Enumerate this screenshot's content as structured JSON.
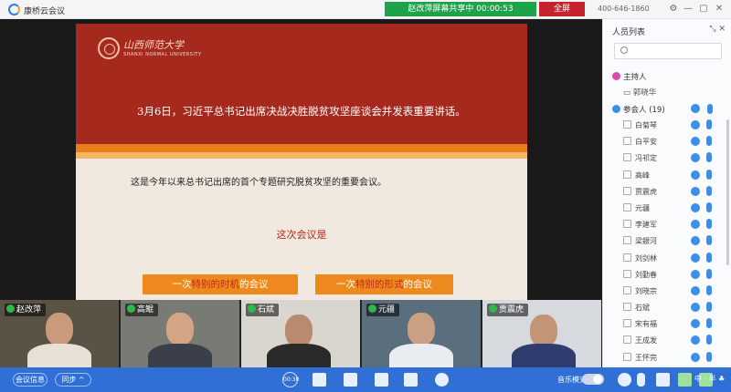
{
  "app": {
    "title": "康桥云会议",
    "hotline": "400-646-1860"
  },
  "share_bar": {
    "text": "赵改萍屏幕共享中 00:00:53",
    "fullscreen_label": "全屏"
  },
  "slide": {
    "school_name": "山西师范大学",
    "school_name_en": "SHANXI NORMAL UNIVERSITY",
    "headline": "3月6日，习近平总书记出席决战决胜脱贫攻坚座谈会并发表重要讲话。",
    "line1": "这是今年以来总书记出席的首个专题研究脱贫攻坚的重要会议。",
    "line2": "这次会议是",
    "box1": {
      "pre": "一次",
      "hl": "特别的时机",
      "post": "的会议"
    },
    "box2": {
      "pre": "一次",
      "hl": "特别的形式",
      "post": "的会议"
    },
    "colors": {
      "banner": "#a6291e",
      "box": "#ee8a1d"
    }
  },
  "thumbnails": [
    {
      "name": "赵改萍"
    },
    {
      "name": "高鲲"
    },
    {
      "name": "石斌"
    },
    {
      "name": "元疆"
    },
    {
      "name": "贾震虎"
    }
  ],
  "panel": {
    "title": "人员列表",
    "host_label": "主持人",
    "host_name": "郭晓华",
    "attendee_label": "参会人 (19)",
    "attendees": [
      "白菊琴",
      "白平安",
      "冯祁定",
      "高峰",
      "贾震虎",
      "元疆",
      "李建军",
      "梁銀河",
      "刘剑林",
      "刘勤春",
      "刘晓宗",
      "石斌",
      "宋有福",
      "王成发",
      "王怀完"
    ]
  },
  "toolbar": {
    "meeting_info": "会议信息",
    "sync": "同步 ^",
    "timer": "00:30",
    "music_mode": "音乐模式",
    "ime": "中 · 半 ♣"
  }
}
